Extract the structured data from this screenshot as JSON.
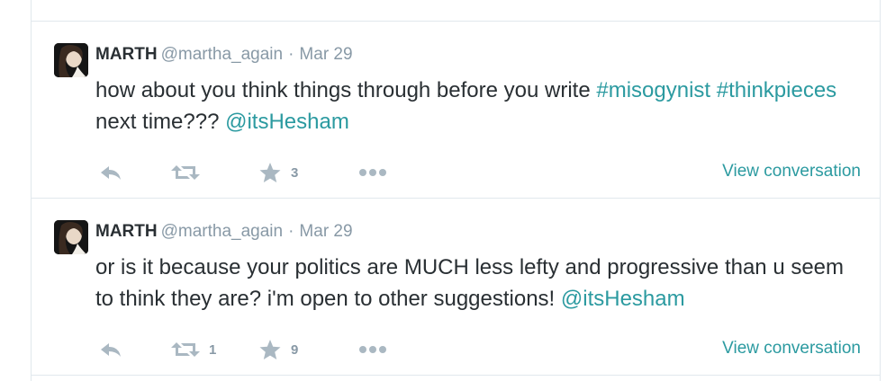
{
  "tweets": [
    {
      "fullname": "MARTH",
      "username": "@martha_again",
      "separator": "·",
      "time": "Mar 29",
      "text_parts": {
        "t0": "how about you think things through before you write ",
        "h1": "#misogynist",
        "t1": " ",
        "h2": "#thinkpieces",
        "t2": " next time??? ",
        "m1": "@itsHesham"
      },
      "retweet_count": "",
      "favorite_count": "3",
      "view_conversation": "View conversation"
    },
    {
      "fullname": "MARTH",
      "username": "@martha_again",
      "separator": "·",
      "time": "Mar 29",
      "text_parts": {
        "t0": "or is it because your politics are MUCH less lefty and progressive than u seem to think they are? i'm open to other suggestions! ",
        "m1": "@itsHesham"
      },
      "retweet_count": "1",
      "favorite_count": "9",
      "view_conversation": "View conversation"
    }
  ],
  "colors": {
    "link": "#2b9aa0",
    "name": "#292f33",
    "muted": "#8899a6",
    "icon": "#aab8c2",
    "border": "#e1e8ed"
  },
  "icons": [
    "reply-icon",
    "retweet-icon",
    "favorite-icon",
    "more-icon"
  ]
}
